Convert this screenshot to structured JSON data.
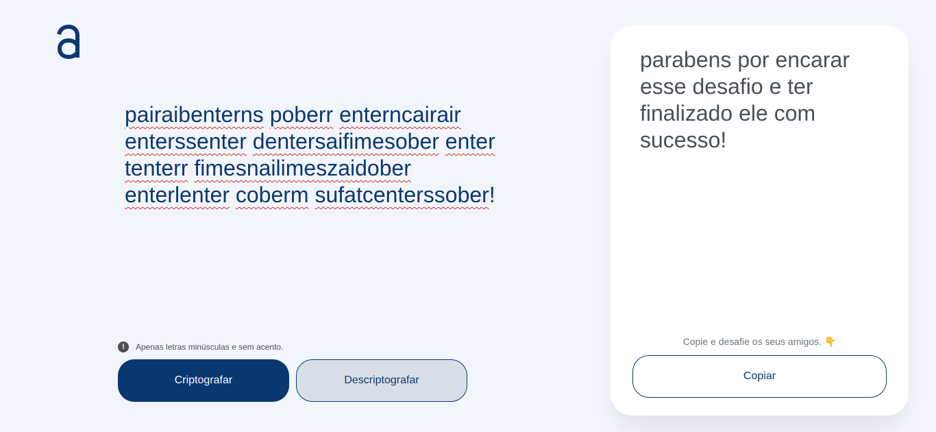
{
  "brand": {
    "logo_icon": "alura-a-logo-icon",
    "primary_color": "#0a3871"
  },
  "editor": {
    "words": [
      "pairaibenterns",
      "poberr",
      "enterncairair",
      "enterssenter",
      "dentersaifimesober",
      "enter",
      "tenterr",
      "fimesnailimeszaidober",
      "enterlenter",
      "coberm",
      "sufatcenterssober"
    ],
    "trailing_punct": "!"
  },
  "hint": {
    "icon": "exclamation-circle-icon",
    "text": "Apenas letras minúsculas e sem acento."
  },
  "actions": {
    "encrypt_label": "Criptografar",
    "decrypt_label": "Descriptografar"
  },
  "output": {
    "text": "parabens por encarar esse desafio e ter finalizado ele com sucesso!",
    "note": "Copie e desafie os seus amigos.",
    "note_icon": "pointing-down-hand-icon",
    "copy_label": "Copiar"
  }
}
